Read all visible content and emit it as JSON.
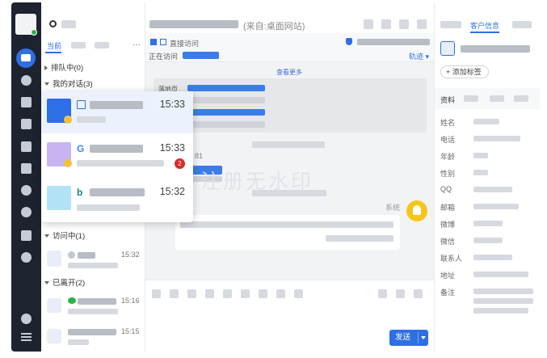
{
  "list": {
    "tab_current": "当前",
    "groups": {
      "queue": "排队中(0)",
      "mine": "我的对话(3)",
      "visiting": "访问中(1)",
      "left": "已离开(2)"
    },
    "visiting_items": [
      {
        "time": "15:32"
      }
    ],
    "left_items": [
      {
        "time": "15:16"
      },
      {
        "time": "15:15"
      }
    ]
  },
  "popup": {
    "items": [
      {
        "time": "15:33",
        "source_icon": "browser-icon",
        "avatar_color": "#2c6fe6"
      },
      {
        "time": "15:33",
        "source_icon": "google-icon",
        "avatar_color": "#c8b4f0",
        "badge": "2"
      },
      {
        "time": "15:32",
        "source_icon": "bing-icon",
        "avatar_color": "#b2e2f6"
      }
    ]
  },
  "chat": {
    "header_suffix": "(来自:桌面网站)",
    "direct_visit": "直接访问",
    "now_visiting": "正在访问",
    "track": "轨迹",
    "see_more": "查看更多",
    "landing_label": "落地页",
    "partial_number": "81",
    "system_label": "系统",
    "send_label": "发送"
  },
  "info": {
    "tab_customer": "客户信息",
    "add_tag": "添加标签",
    "section_title": "资料",
    "fields": [
      "姓名",
      "电话",
      "年龄",
      "性别",
      "QQ",
      "邮箱",
      "微博",
      "微信",
      "联系人",
      "地址",
      "备注"
    ]
  },
  "watermark": "注册无水印",
  "colors": {
    "accent": "#2f6fe4",
    "rail_bg": "#1e2330",
    "badge": "#d92c2c",
    "system_avatar": "#f5c518"
  }
}
